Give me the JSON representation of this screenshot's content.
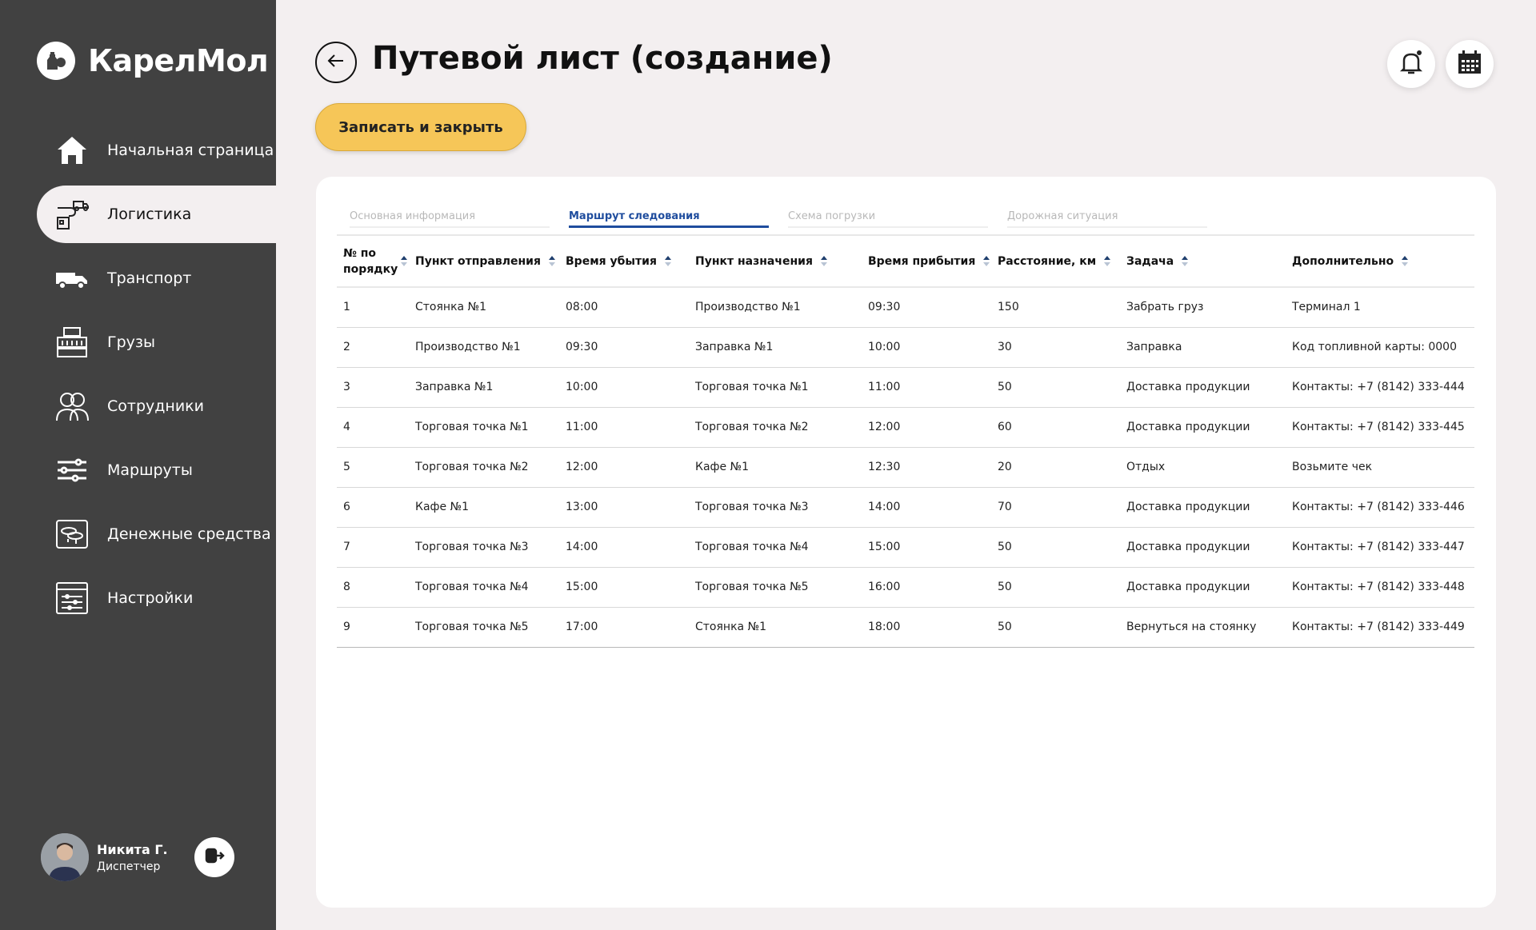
{
  "app": {
    "name": "КарелМол"
  },
  "sidebar": {
    "items": [
      {
        "label": "Начальная страница",
        "icon": "home-icon"
      },
      {
        "label": "Логистика",
        "icon": "logistics-icon"
      },
      {
        "label": "Транспорт",
        "icon": "truck-icon"
      },
      {
        "label": "Грузы",
        "icon": "cargo-icon"
      },
      {
        "label": "Сотрудники",
        "icon": "employees-icon"
      },
      {
        "label": "Маршруты",
        "icon": "routes-icon"
      },
      {
        "label": "Денежные средства",
        "icon": "money-icon"
      },
      {
        "label": "Настройки",
        "icon": "settings-icon"
      }
    ],
    "active_index": 1
  },
  "user": {
    "name": "Никита Г.",
    "role": "Диспетчер"
  },
  "header": {
    "title": "Путевой лист (создание)",
    "save_label": "Записать и закрыть"
  },
  "tabs": [
    {
      "label": "Основная информация",
      "active": false
    },
    {
      "label": "Маршрут следования",
      "active": true
    },
    {
      "label": "Схема погрузки",
      "active": false
    },
    {
      "label": "Дорожная ситуация",
      "active": false
    }
  ],
  "table": {
    "columns": [
      "№ по порядку",
      "Пункт отправления",
      "Время убытия",
      "Пункт назначения",
      "Время прибытия",
      "Расстояние, км",
      "Задача",
      "Дополнительно"
    ],
    "rows": [
      [
        "1",
        "Стоянка №1",
        "08:00",
        "Производство №1",
        "09:30",
        "150",
        "Забрать груз",
        "Терминал 1"
      ],
      [
        "2",
        "Производство №1",
        "09:30",
        "Заправка №1",
        "10:00",
        "30",
        "Заправка",
        "Код топливной карты: 0000"
      ],
      [
        "3",
        "Заправка №1",
        "10:00",
        "Торговая точка №1",
        "11:00",
        "50",
        "Доставка продукции",
        "Контакты: +7 (8142) 333-444"
      ],
      [
        "4",
        "Торговая точка №1",
        "11:00",
        "Торговая точка №2",
        "12:00",
        "60",
        "Доставка продукции",
        "Контакты: +7 (8142) 333-445"
      ],
      [
        "5",
        "Торговая точка №2",
        "12:00",
        "Кафе №1",
        "12:30",
        "20",
        "Отдых",
        "Возьмите чек"
      ],
      [
        "6",
        "Кафе №1",
        "13:00",
        "Торговая точка №3",
        "14:00",
        "70",
        "Доставка продукции",
        "Контакты: +7 (8142) 333-446"
      ],
      [
        "7",
        "Торговая точка №3",
        "14:00",
        "Торговая точка №4",
        "15:00",
        "50",
        "Доставка продукции",
        "Контакты: +7 (8142) 333-447"
      ],
      [
        "8",
        "Торговая точка №4",
        "15:00",
        "Торговая точка №5",
        "16:00",
        "50",
        "Доставка продукции",
        "Контакты: +7 (8142) 333-448"
      ],
      [
        "9",
        "Торговая точка №5",
        "17:00",
        "Стоянка №1",
        "18:00",
        "50",
        "Вернуться на стоянку",
        "Контакты: +7 (8142) 333-449"
      ]
    ]
  },
  "colors": {
    "sidebar_bg": "#414141",
    "page_bg": "#f3eff0",
    "accent_yellow": "#f6c658",
    "tab_active": "#1f4d9e"
  }
}
